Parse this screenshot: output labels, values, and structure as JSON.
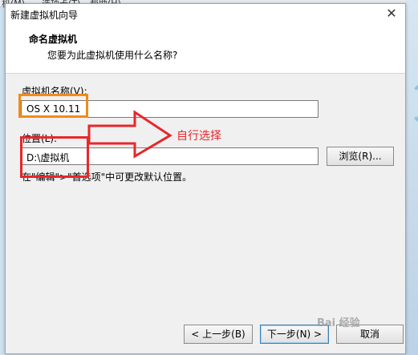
{
  "background": {
    "menu_fragments": [
      "机(M)",
      "选项卡(T)",
      "帮助(H)"
    ]
  },
  "dialog": {
    "title": "新建虚拟机向导",
    "close_glyph": "✕"
  },
  "header": {
    "title": "命名虚拟机",
    "subtitle": "您要为此虚拟机使用什么名称?"
  },
  "form": {
    "name_label": "虚拟机名称(V):",
    "name_value": "OS X 10.11",
    "location_label": "位置(L):",
    "location_value": "D:\\虚拟机",
    "browse_button": "浏览(R)...",
    "hint": "在\"编辑\">\"首选项\"中可更改默认位置。"
  },
  "annotation": {
    "text": "自行选择",
    "color": "#e8262b",
    "highlight_color": "#f28a1a"
  },
  "footer": {
    "back_button": "< 上一步(B)",
    "next_button": "下一步(N) >",
    "cancel_button": "取消"
  },
  "watermark": "Bai 经验"
}
